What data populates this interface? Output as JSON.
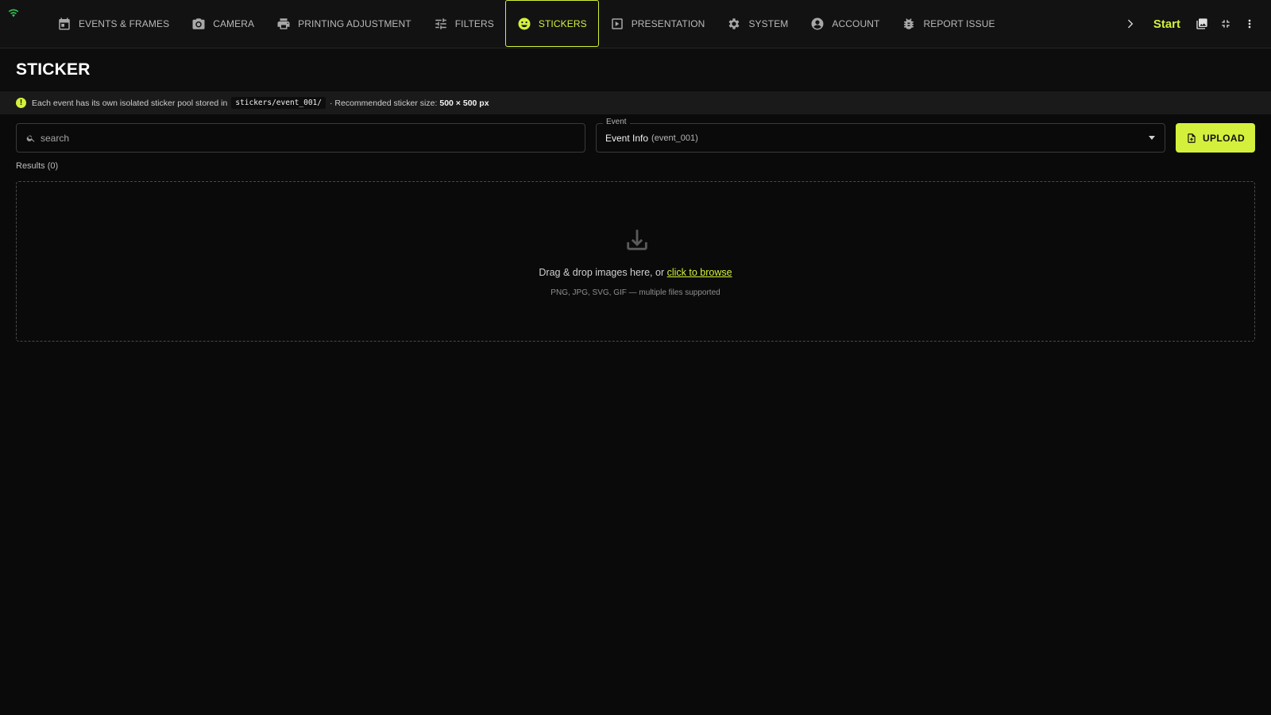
{
  "nav": {
    "items": [
      {
        "label": "EVENTS & FRAMES",
        "icon": "calendar-icon"
      },
      {
        "label": "CAMERA",
        "icon": "camera-icon"
      },
      {
        "label": "PRINTING ADJUSTMENT",
        "icon": "printer-icon"
      },
      {
        "label": "FILTERS",
        "icon": "sliders-icon"
      },
      {
        "label": "STICKERS",
        "icon": "smiley-icon",
        "active": true
      },
      {
        "label": "PRESENTATION",
        "icon": "play-box-icon"
      },
      {
        "label": "SYSTEM",
        "icon": "gear-icon"
      },
      {
        "label": "ACCOUNT",
        "icon": "user-circle-icon"
      },
      {
        "label": "REPORT ISSUE",
        "icon": "bug-icon"
      }
    ],
    "start_label": "Start",
    "accent_color": "#d4f03c"
  },
  "page": {
    "title": "STICKER"
  },
  "info": {
    "text_before": "Each event has its own isolated sticker pool stored in",
    "path": "stickers/event_001/",
    "text_after": "· Recommended sticker size:",
    "size": "500 × 500 px"
  },
  "search": {
    "placeholder": "search",
    "value": ""
  },
  "event_select": {
    "label": "Event",
    "value": "Event Info",
    "id_suffix": "(event_001)"
  },
  "upload": {
    "label": "UPLOAD"
  },
  "results": {
    "label": "Results (0)"
  },
  "dropzone": {
    "text": "Drag & drop images here, or",
    "link": "click to browse",
    "hint": "PNG, JPG, SVG, GIF — multiple files supported"
  }
}
